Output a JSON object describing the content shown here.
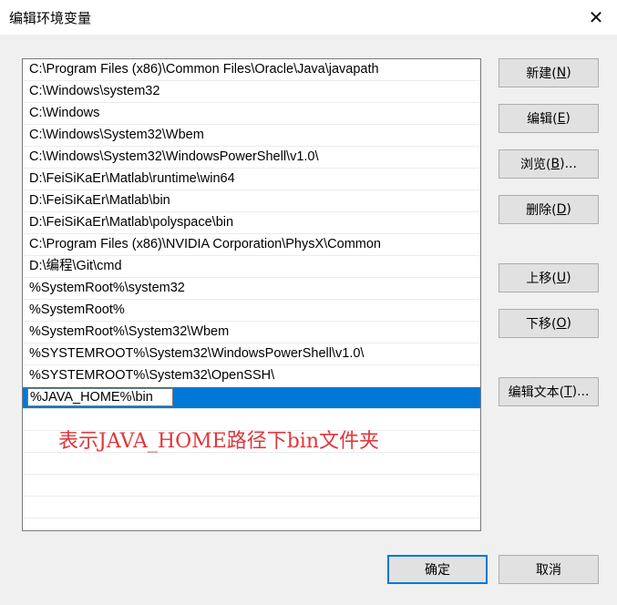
{
  "window": {
    "title": "编辑环境变量",
    "close_glyph": "✕"
  },
  "paths": [
    "C:\\Program Files (x86)\\Common Files\\Oracle\\Java\\javapath",
    "C:\\Windows\\system32",
    "C:\\Windows",
    "C:\\Windows\\System32\\Wbem",
    "C:\\Windows\\System32\\WindowsPowerShell\\v1.0\\",
    "D:\\FeiSiKaEr\\Matlab\\runtime\\win64",
    "D:\\FeiSiKaEr\\Matlab\\bin",
    "D:\\FeiSiKaEr\\Matlab\\polyspace\\bin",
    "C:\\Program Files (x86)\\NVIDIA Corporation\\PhysX\\Common",
    "D:\\编程\\Git\\cmd",
    "%SystemRoot%\\system32",
    "%SystemRoot%",
    "%SystemRoot%\\System32\\Wbem",
    "%SYSTEMROOT%\\System32\\WindowsPowerShell\\v1.0\\",
    "%SYSTEMROOT%\\System32\\OpenSSH\\"
  ],
  "editing_value": "%JAVA_HOME%\\bin",
  "annotation": "表示JAVA_HOME路径下bin文件夹",
  "buttons": {
    "new": {
      "label": "新建(",
      "key": "N",
      "suffix": ")"
    },
    "edit": {
      "label": "编辑(",
      "key": "E",
      "suffix": ")"
    },
    "browse": {
      "label": "浏览(",
      "key": "B",
      "suffix": ")..."
    },
    "delete": {
      "label": "删除(",
      "key": "D",
      "suffix": ")"
    },
    "up": {
      "label": "上移(",
      "key": "U",
      "suffix": ")"
    },
    "down": {
      "label": "下移(",
      "key": "O",
      "suffix": ")"
    },
    "edit_text": {
      "label": "编辑文本(",
      "key": "T",
      "suffix": ")..."
    },
    "ok": "确定",
    "cancel": "取消"
  }
}
